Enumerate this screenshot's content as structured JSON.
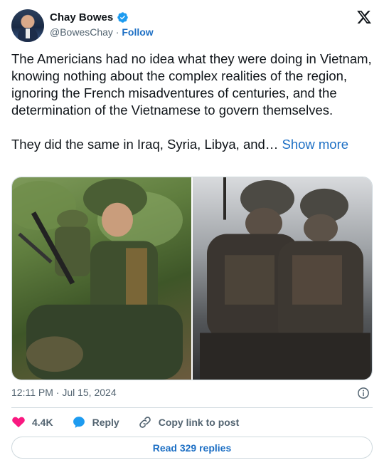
{
  "author": {
    "name": "Chay Bowes",
    "handle": "@BowesChay",
    "separator": " · ",
    "follow_label": "Follow"
  },
  "tweet": {
    "paragraph_1": "The Americians had no idea what they were doing in Vietnam, knowing nothing about the complex realities of the region, ignoring the French misadventures of centuries, and the determination of the Vietnamese to govern themselves.",
    "paragraph_2": "They did the same in Iraq, Syria, Libya, and… ",
    "show_more_label": "Show more"
  },
  "media": {
    "left_photo": "soldiers-vietnam-photo",
    "right_photo": "soldiers-muddy-photo"
  },
  "meta": {
    "timestamp": "12:11 PM · Jul 15, 2024"
  },
  "actions": {
    "likes": "4.4K",
    "reply_label": "Reply",
    "copy_label": "Copy link to post"
  },
  "read_replies_label": "Read 329 replies",
  "colors": {
    "accent": "#1d9bf0",
    "link": "#1d6fc4",
    "heart": "#f91880",
    "text": "#0f1419",
    "muted": "#536471",
    "border": "#cfd9de"
  }
}
